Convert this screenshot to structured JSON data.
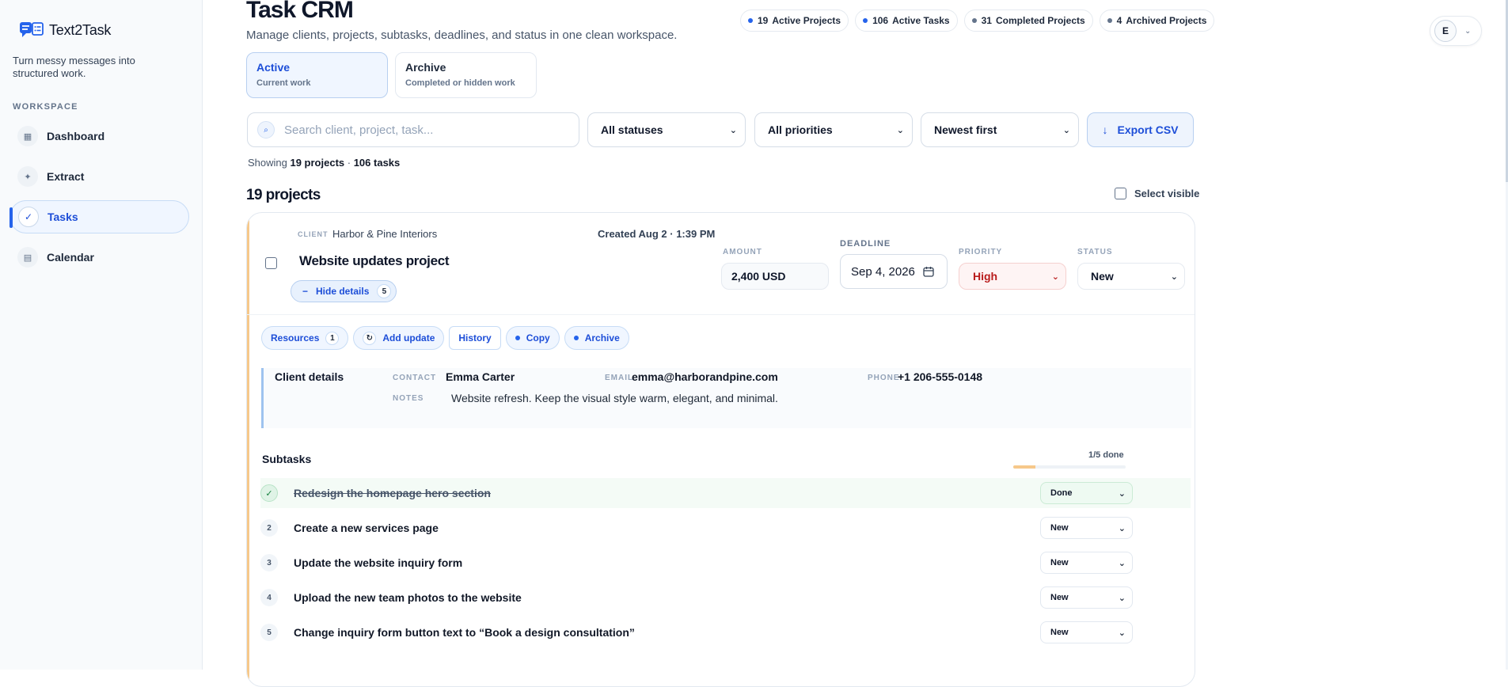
{
  "app": {
    "name": "Text2Task",
    "tagline": "Turn messy messages into structured work."
  },
  "sidebar": {
    "section_label": "WORKSPACE",
    "items": [
      {
        "label": "Dashboard",
        "icon": "grid-icon"
      },
      {
        "label": "Extract",
        "icon": "sparkle-icon"
      },
      {
        "label": "Tasks",
        "icon": "check-icon"
      },
      {
        "label": "Calendar",
        "icon": "calendar-icon"
      }
    ],
    "active": "Tasks"
  },
  "header": {
    "title": "Task CRM",
    "subtitle": "Manage clients, projects, subtasks, deadlines, and status in one clean workspace.",
    "stats": [
      {
        "num": "19",
        "label": "Active Projects",
        "color": "#2563eb"
      },
      {
        "num": "106",
        "label": "Active Tasks",
        "color": "#2563eb"
      },
      {
        "num": "31",
        "label": "Completed Projects",
        "color": "#64748b"
      },
      {
        "num": "4",
        "label": "Archived Projects",
        "color": "#64748b"
      }
    ],
    "avatar_initial": "E"
  },
  "tabs": [
    {
      "title": "Active",
      "sub": "Current work"
    },
    {
      "title": "Archive",
      "sub": "Completed or hidden work"
    }
  ],
  "filters": {
    "search_placeholder": "Search client, project, task...",
    "status": "All statuses",
    "priority": "All priorities",
    "sort": "Newest first",
    "export_label": "Export CSV"
  },
  "summary": {
    "prefix": "Showing ",
    "projects": "19 projects",
    "sep": " · ",
    "tasks": "106 tasks"
  },
  "list": {
    "count_title": "19 projects",
    "select_visible": "Select visible"
  },
  "project": {
    "client_label": "CLIENT",
    "client": "Harbor & Pine Interiors",
    "created": "Created Aug 2 · 1:39 PM",
    "name": "Website updates project",
    "hide_details": "Hide details",
    "subtask_count": "5",
    "amount_label": "AMOUNT",
    "amount": "2,400 USD",
    "deadline_label": "DEADLINE",
    "deadline": "Sep 4, 2026",
    "priority_label": "PRIORITY",
    "priority": "High",
    "status_label": "STATUS",
    "status": "New",
    "actions": {
      "resources": "Resources",
      "resources_count": "1",
      "add_update": "Add update",
      "history": "History",
      "copy": "Copy",
      "archive": "Archive"
    },
    "details": {
      "title": "Client details",
      "contact_label": "CONTACT",
      "contact": "Emma Carter",
      "email_label": "EMAIL",
      "email": "emma@harborandpine.com",
      "phone_label": "PHONE",
      "phone": "+1 206-555-0148",
      "notes_label": "NOTES",
      "notes": "Website refresh. Keep the visual style warm, elegant, and minimal."
    },
    "subtasks_title": "Subtasks",
    "done_text": "1/5 done",
    "progress": 0.2,
    "subtasks": [
      {
        "num": "✓",
        "text": "Redesign the homepage hero section",
        "status": "Done",
        "done": true
      },
      {
        "num": "2",
        "text": "Create a new services page",
        "status": "New",
        "done": false
      },
      {
        "num": "3",
        "text": "Update the website inquiry form",
        "status": "New",
        "done": false
      },
      {
        "num": "4",
        "text": "Upload the new team photos to the website",
        "status": "New",
        "done": false
      },
      {
        "num": "5",
        "text": "Change inquiry form button text to “Book a design consultation”",
        "status": "New",
        "done": false
      }
    ]
  }
}
